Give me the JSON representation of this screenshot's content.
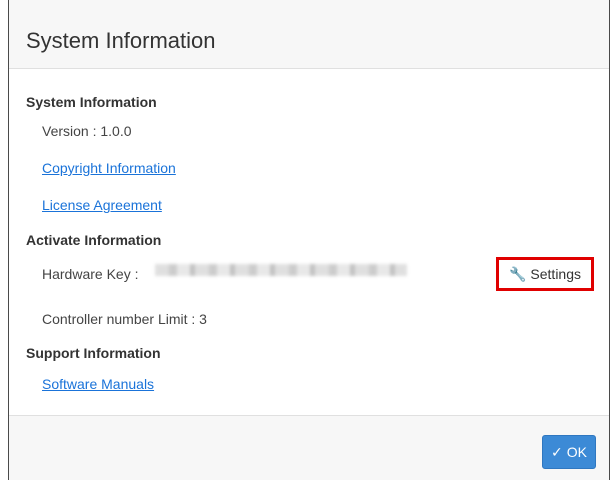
{
  "dialog": {
    "title": "System Information"
  },
  "system_section": {
    "title": "System Information",
    "version_text": "Version : 1.0.0",
    "copyright_link": "Copyright Information",
    "license_link": "License Agreement"
  },
  "activate_section": {
    "title": "Activate Information",
    "hardware_key_label": "Hardware Key :",
    "settings_button": "Settings",
    "settings_icon": "wrench-icon",
    "controller_limit_text": "Controller number Limit : 3"
  },
  "support_section": {
    "title": "Support Information",
    "manuals_link": "Software Manuals"
  },
  "footer": {
    "ok_button": "OK",
    "ok_icon": "check-icon"
  },
  "colors": {
    "link": "#1a73d9",
    "primary_button": "#3c8ad6",
    "highlight_border": "#e00000"
  }
}
